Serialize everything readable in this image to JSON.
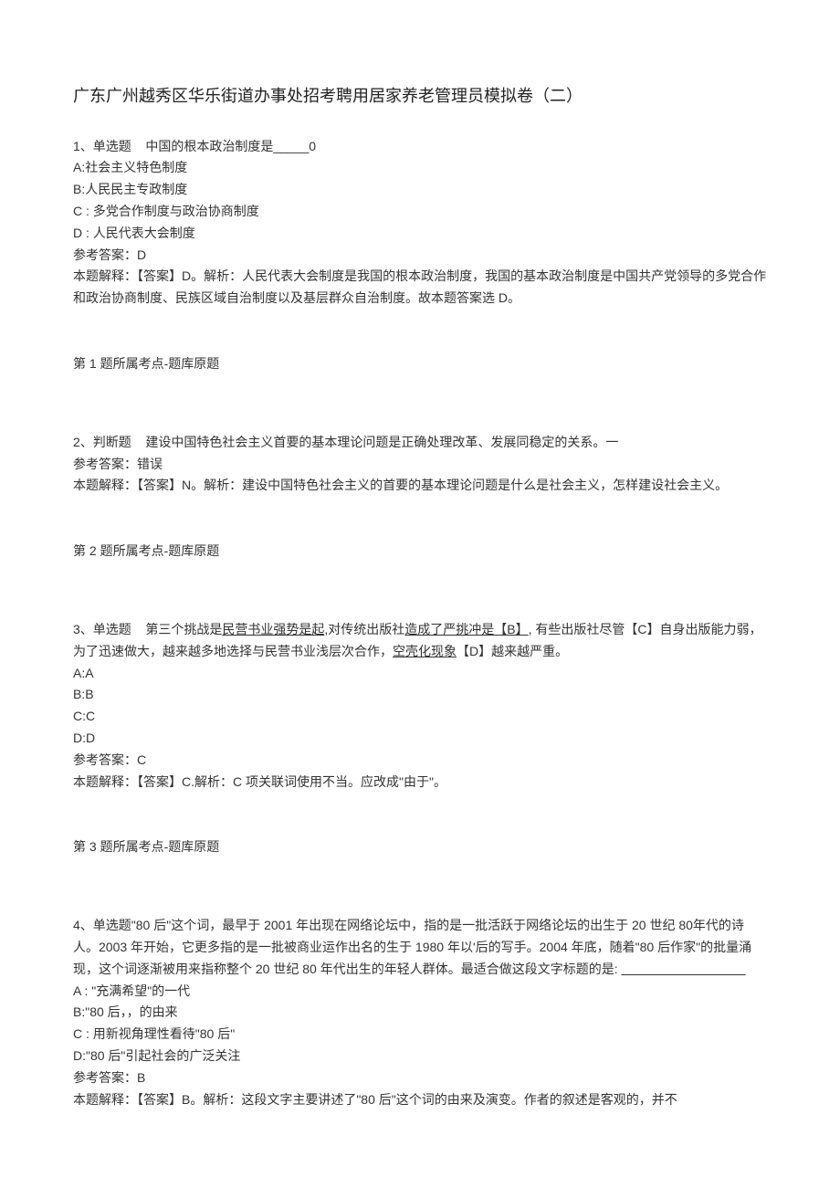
{
  "title": "广东广州越秀区华乐街道办事处招考聘用居家养老管理员模拟卷（二）",
  "q1": {
    "prompt_label": "1、单选题",
    "prompt_text": "中国的根本政治制度是_____0",
    "opt_a": "A:社会主义特色制度",
    "opt_b": "B:人民民主专政制度",
    "opt_c": "C : 多党合作制度与政治协商制度",
    "opt_d": "D : 人民代表大会制度",
    "answer_label": "参考答案：D",
    "explain": "本题解释：【答案】D。解析：人民代表大会制度是我国的根本政治制度，我国的基本政治制度是中国共产党领导的多党合作和政治协商制度、民族区域自治制度以及基层群众自治制度。故本题答案选 D。",
    "category": "第 1 题所属考点-题库原题"
  },
  "q2": {
    "prompt_label": "2、判断题",
    "prompt_text": "建设中国特色社会主义首要的基本理论问题是正确处理改革、发展同稳定的关系。一",
    "answer_label": "参考答案：错误",
    "explain": "本题解释：【答案】N。解析：建设中国特色社会主义的首要的基本理论问题是什么是社会主义，怎样建设社会主义。",
    "category": "第 2 题所属考点-题库原题"
  },
  "q3": {
    "prompt_label": "3、单选题",
    "prompt_text_before": "第三个挑战是",
    "prompt_u1": "民营书业强势是起",
    "prompt_text_mid1": ",对传统出版社",
    "prompt_u2": "造成了严挑冲是【B】",
    "prompt_text_mid2": ", 有些出版社尽管【C】自身出版能力弱，为了迅速做大，越来越多地选择与民营书业浅层次合作，",
    "prompt_u3": "空壳化现象",
    "prompt_text_after": "【D】越来越严重。",
    "opt_a": "A:A",
    "opt_b": "B:B",
    "opt_c": "C:C",
    "opt_d": "D:D",
    "answer_label": "参考答案：C",
    "explain": "本题解释：【答案】C.解析：C 项关联词使用不当。应改成\"由于\"。",
    "category": "第 3 题所属考点-题库原题"
  },
  "q4": {
    "prompt_label": "4、单选题",
    "prompt_text": "\"80 后\"这个词，最早于 2001 年出现在网络论坛中，指的是一批活跃于网络论坛的出生于 20 世纪 80年代的诗人。2003 年开始，它更多指的是一批被商业运作出名的生于 1980 年以'后的写手。2004 年底，随着\"80 后作家\"的批量涌现，这个词逐渐被用来指称整个 20 世纪 80 年代出生的年轻人群体。最适合做这段文字标题的是:",
    "blank_line": " ",
    "opt_a": "A : \"充满希望\"的一代",
    "opt_b": "B:\"80 后，，的由来",
    "opt_c": "C : 用新视角理性看待\"80 后\"",
    "opt_d": "D:\"80 后\"引起社会的广泛关注",
    "answer_label": "参考答案：B",
    "explain": "本题解释：【答案】B。解析：这段文字主要讲述了\"80 后\"这个词的由来及演变。作者的叙述是客观的，并不"
  }
}
